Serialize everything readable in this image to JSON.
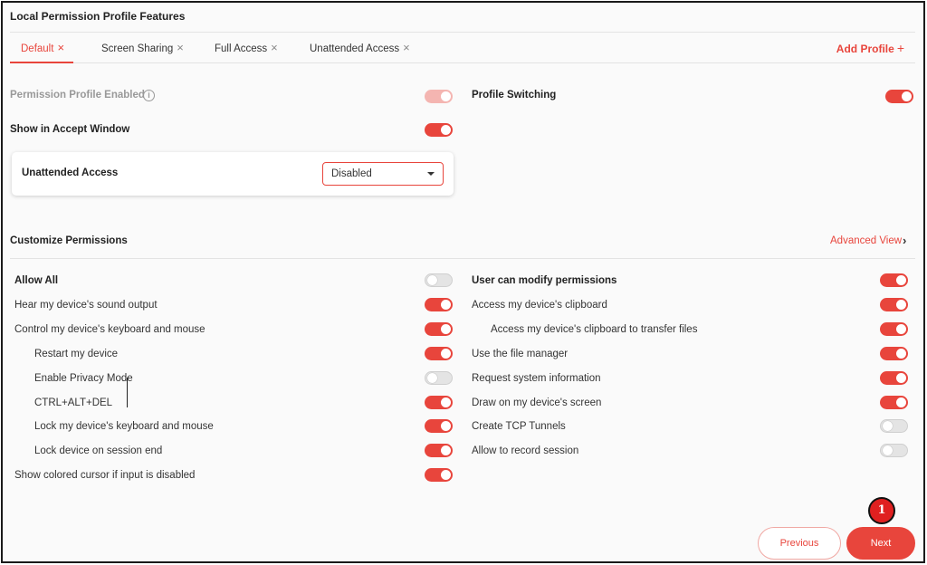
{
  "title": "Local Permission Profile Features",
  "tabs": [
    {
      "label": "Default",
      "active": true
    },
    {
      "label": "Screen Sharing",
      "active": false
    },
    {
      "label": "Full Access",
      "active": false
    },
    {
      "label": "Unattended Access",
      "active": false
    }
  ],
  "tab_close_glyph": "×",
  "add_profile": {
    "label": "Add Profile",
    "icon": "+"
  },
  "top_settings": {
    "permission_profile_enabled": {
      "label": "Permission Profile Enabled",
      "state": "on-disabled",
      "info_icon": "i"
    },
    "profile_switching": {
      "label": "Profile Switching",
      "state": "on"
    },
    "show_in_accept_window": {
      "label": "Show in Accept Window",
      "state": "on"
    },
    "unattended_access": {
      "label": "Unattended Access",
      "selected": "Disabled"
    }
  },
  "customize": {
    "heading": "Customize Permissions",
    "advanced_view": "Advanced View",
    "chevron": "›"
  },
  "left_permissions": [
    {
      "label": "Allow All",
      "state": "off",
      "bold": true,
      "indent": false
    },
    {
      "label": "Hear my device's sound output",
      "state": "on",
      "indent": false
    },
    {
      "label": "Control my device's keyboard and mouse",
      "state": "on",
      "indent": false
    },
    {
      "label": "Restart my device",
      "state": "on",
      "indent": true
    },
    {
      "label": "Enable Privacy Mode",
      "state": "off",
      "indent": true
    },
    {
      "label": "CTRL+ALT+DEL",
      "state": "on",
      "indent": true
    },
    {
      "label": "Lock my device's keyboard and mouse",
      "state": "on",
      "indent": true
    },
    {
      "label": "Lock device on session end",
      "state": "on",
      "indent": true
    },
    {
      "label": "Show colored cursor if input is disabled",
      "state": "on",
      "indent": false
    }
  ],
  "right_permissions": [
    {
      "label": "User can modify permissions",
      "state": "on",
      "bold": true,
      "indent": false
    },
    {
      "label": "Access my device's clipboard",
      "state": "on",
      "indent": false
    },
    {
      "label": "Access my device's clipboard to transfer files",
      "state": "on",
      "indent": true
    },
    {
      "label": "Use the file manager",
      "state": "on",
      "indent": false
    },
    {
      "label": "Request system information",
      "state": "on",
      "indent": false
    },
    {
      "label": "Draw on my device's screen",
      "state": "on",
      "indent": false
    },
    {
      "label": "Create TCP Tunnels",
      "state": "off",
      "indent": false
    },
    {
      "label": "Allow to record session",
      "state": "off",
      "indent": false
    }
  ],
  "buttons": {
    "previous": "Previous",
    "next": "Next"
  },
  "step_badge": "1",
  "colors": {
    "accent": "#e8453c",
    "toggle_off": "#e4e4e4",
    "badge": "#e02020"
  }
}
